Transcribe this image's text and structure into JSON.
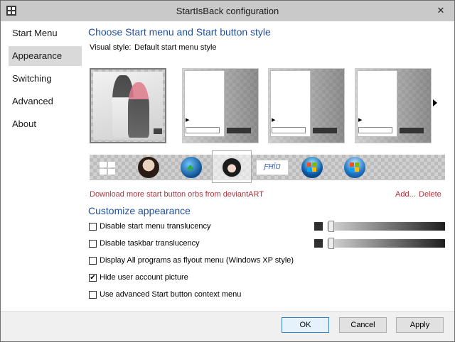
{
  "window": {
    "title": "StartIsBack configuration",
    "close_glyph": "✕"
  },
  "sidebar": {
    "items": [
      {
        "label": "Start Menu",
        "active": false
      },
      {
        "label": "Appearance",
        "active": true
      },
      {
        "label": "Switching",
        "active": false
      },
      {
        "label": "Advanced",
        "active": false
      },
      {
        "label": "About",
        "active": false
      }
    ]
  },
  "style_section": {
    "title": "Choose Start menu and Start button style",
    "visual_style_label": "Visual style:",
    "visual_style_value": "Default start menu style",
    "thumbnails_count_visible": 4,
    "selected_thumbnail": 1
  },
  "orbs": {
    "items": [
      "windows8-logo",
      "anime-portrait-orb",
      "clover-orb",
      "anime-boy-orb",
      "logo-banner-orb",
      "windows7-orb",
      "windows7-orb-blue"
    ],
    "selected": 4,
    "banner_text": "ƑĦĪŊ"
  },
  "links": {
    "download": "Download more start button orbs from deviantART",
    "add": "Add...",
    "delete": "Delete"
  },
  "customize": {
    "title": "Customize appearance",
    "options": [
      {
        "label": "Disable start menu translucency",
        "checked": false
      },
      {
        "label": "Disable taskbar translucency",
        "checked": false
      },
      {
        "label": "Display All programs as flyout menu (Windows XP style)",
        "checked": false
      },
      {
        "label": "Hide user account picture",
        "checked": true
      },
      {
        "label": "Use advanced Start button context menu",
        "checked": false
      }
    ],
    "check_glyph": "✔"
  },
  "colors": {
    "accent": "#1f4e9a",
    "link": "#b0303a",
    "orb_bar": "#2a2a2a"
  },
  "footer": {
    "ok": "OK",
    "cancel": "Cancel",
    "apply": "Apply"
  }
}
